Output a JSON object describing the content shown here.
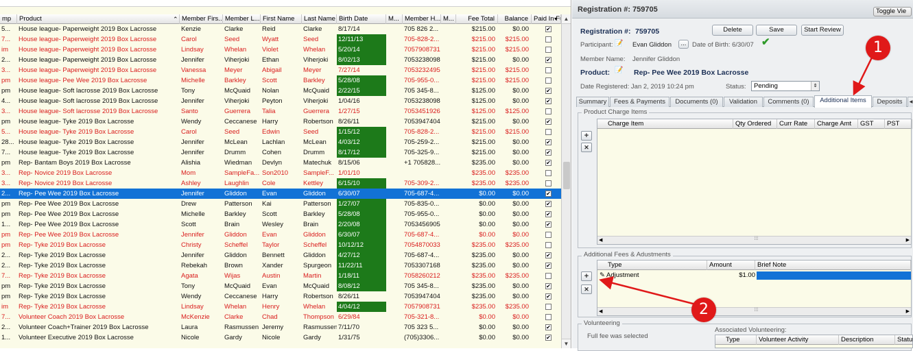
{
  "grid": {
    "columns": [
      {
        "label": "mp"
      },
      {
        "label": "Product"
      },
      {
        "label": "Member Firs..."
      },
      {
        "label": "Member L..."
      },
      {
        "label": "First Name"
      },
      {
        "label": "Last Name"
      },
      {
        "label": "Birth Date"
      },
      {
        "label": "M..."
      },
      {
        "label": "Member H..."
      },
      {
        "label": "M..."
      },
      {
        "label": "Fee Total"
      },
      {
        "label": "Balance"
      },
      {
        "label": "Paid In Fu"
      }
    ],
    "rows": [
      {
        "c0": "5...",
        "product": "House league- Paperweight 2019 Box Lacrosse",
        "mfirst": "Kenzie",
        "mlast": "Clarke",
        "first": "Reid",
        "last": "Clarke",
        "birth": "8/17/14",
        "green": false,
        "phone": "705 826 2...",
        "fee": "$215.00",
        "bal": "$0.00",
        "paid": true,
        "red": false
      },
      {
        "c0": "7...",
        "product": "House league- Paperweight 2019 Box Lacrosse",
        "mfirst": "Carol",
        "mlast": "Seed",
        "first": "Wyatt",
        "last": "Seed",
        "birth": "12/11/13",
        "green": true,
        "phone": "705-828-2...",
        "fee": "$215.00",
        "bal": "$215.00",
        "paid": false,
        "red": true
      },
      {
        "c0": "im",
        "product": "House league- Paperweight 2019 Box Lacrosse",
        "mfirst": "Lindsay",
        "mlast": "Whelan",
        "first": "Violet",
        "last": "Whelan",
        "birth": "5/20/14",
        "green": true,
        "phone": "7057908731",
        "fee": "$215.00",
        "bal": "$215.00",
        "paid": false,
        "red": true
      },
      {
        "c0": "2...",
        "product": "House league- Paperweight 2019 Box Lacrosse",
        "mfirst": "Jennifer",
        "mlast": "Viherjoki",
        "first": "Ethan",
        "last": "Viherjoki",
        "birth": "8/02/13",
        "green": true,
        "phone": "7053238098",
        "fee": "$215.00",
        "bal": "$0.00",
        "paid": true,
        "red": false
      },
      {
        "c0": "3...",
        "product": "House league- Paperweight 2019 Box Lacrosse",
        "mfirst": "Vanessa",
        "mlast": "Meyer",
        "first": "Abigail",
        "last": "Meyer",
        "birth": "7/27/14",
        "green": false,
        "phone": "7053232495",
        "fee": "$215.00",
        "bal": "$215.00",
        "paid": false,
        "red": true
      },
      {
        "c0": "pm",
        "product": "House league- Pee Wee 2019 Box Lacrosse",
        "mfirst": "Michelle",
        "mlast": "Barkley",
        "first": "Scott",
        "last": "Barkley",
        "birth": "5/28/08",
        "green": true,
        "phone": "705-955-0...",
        "fee": "$215.00",
        "bal": "$215.00",
        "paid": false,
        "red": true
      },
      {
        "c0": "pm",
        "product": "House league- Soft lacrosse 2019 Box Lacrosse",
        "mfirst": "Tony",
        "mlast": "McQuaid",
        "first": "Nolan",
        "last": "McQuaid",
        "birth": "2/22/15",
        "green": true,
        "phone": "705 345-8...",
        "fee": "$125.00",
        "bal": "$0.00",
        "paid": true,
        "red": false
      },
      {
        "c0": "4...",
        "product": "House league- Soft lacrosse 2019 Box Lacrosse",
        "mfirst": "Jennifer",
        "mlast": "Viherjoki",
        "first": "Peyton",
        "last": "Viherjoki",
        "birth": "1/04/16",
        "green": false,
        "phone": "7053238098",
        "fee": "$125.00",
        "bal": "$0.00",
        "paid": true,
        "red": false
      },
      {
        "c0": "3...",
        "product": "House league- Soft lacrosse 2019 Box Lacrosse",
        "mfirst": "Santo",
        "mlast": "Guerrera",
        "first": "Talia",
        "last": "Guerrera",
        "birth": "1/27/15",
        "green": false,
        "phone": "7053451926",
        "fee": "$125.00",
        "bal": "$125.00",
        "paid": false,
        "red": true
      },
      {
        "c0": "pm",
        "product": "House league- Tyke 2019 Box Lacrosse",
        "mfirst": "Wendy",
        "mlast": "Ceccanese",
        "first": "Harry",
        "last": "Robertson",
        "birth": "8/26/11",
        "green": false,
        "phone": "7053947404",
        "fee": "$215.00",
        "bal": "$0.00",
        "paid": true,
        "red": false
      },
      {
        "c0": "5...",
        "product": "House league- Tyke 2019 Box Lacrosse",
        "mfirst": "Carol",
        "mlast": "Seed",
        "first": "Edwin",
        "last": "Seed",
        "birth": "1/15/12",
        "green": true,
        "phone": "705-828-2...",
        "fee": "$215.00",
        "bal": "$215.00",
        "paid": false,
        "red": true
      },
      {
        "c0": "28...",
        "product": "House league- Tyke 2019 Box Lacrosse",
        "mfirst": "Jennifer",
        "mlast": "McLean",
        "first": "Lachlan",
        "last": "McLean",
        "birth": "4/03/12",
        "green": true,
        "phone": "705-259-2...",
        "fee": "$215.00",
        "bal": "$0.00",
        "paid": true,
        "red": false
      },
      {
        "c0": "7...",
        "product": "House league- Tyke 2019 Box Lacrosse",
        "mfirst": "Jennifer",
        "mlast": "Drumm",
        "first": "Cohen",
        "last": "Drumm",
        "birth": "8/17/12",
        "green": true,
        "phone": "705-325-9...",
        "fee": "$215.00",
        "bal": "$0.00",
        "paid": true,
        "red": false
      },
      {
        "c0": "pm",
        "product": "Rep- Bantam Boys 2019 Box Lacrosse",
        "mfirst": "Alishia",
        "mlast": "Wiedman",
        "first": "Devlyn",
        "last": "Matechuk",
        "birth": "8/15/06",
        "green": false,
        "phone": "+1 705828...",
        "fee": "$235.00",
        "bal": "$0.00",
        "paid": true,
        "red": false
      },
      {
        "c0": "3...",
        "product": "Rep- Novice 2019 Box Lacrosse",
        "mfirst": "Mom",
        "mlast": "SampleFa...",
        "first": "Son2010",
        "last": "SampleF...",
        "birth": "1/01/10",
        "green": false,
        "phone": "",
        "fee": "$235.00",
        "bal": "$235.00",
        "paid": false,
        "red": true
      },
      {
        "c0": "3...",
        "product": "Rep- Novice 2019 Box Lacrosse",
        "mfirst": "Ashley",
        "mlast": "Laughlin",
        "first": "Cole",
        "last": "Kettley",
        "birth": "6/15/10",
        "green": true,
        "phone": "705-309-2...",
        "fee": "$235.00",
        "bal": "$235.00",
        "paid": false,
        "red": true
      },
      {
        "c0": "2...",
        "product": "Rep- Pee Wee 2019 Box Lacrosse",
        "mfirst": "Jennifer",
        "mlast": "Gliddon",
        "first": "Evan",
        "last": "Gliddon",
        "birth": "6/30/07",
        "green": false,
        "phone": "705-687-4...",
        "fee": "$0.00",
        "bal": "$0.00",
        "paid": true,
        "red": false,
        "selected": true
      },
      {
        "c0": "pm",
        "product": "Rep- Pee Wee 2019 Box Lacrosse",
        "mfirst": "Drew",
        "mlast": "Patterson",
        "first": "Kai",
        "last": "Patterson",
        "birth": "1/27/07",
        "green": true,
        "phone": "705-835-0...",
        "fee": "$0.00",
        "bal": "$0.00",
        "paid": true,
        "red": false
      },
      {
        "c0": "pm",
        "product": "Rep- Pee Wee 2019 Box Lacrosse",
        "mfirst": "Michelle",
        "mlast": "Barkley",
        "first": "Scott",
        "last": "Barkley",
        "birth": "5/28/08",
        "green": true,
        "phone": "705-955-0...",
        "fee": "$0.00",
        "bal": "$0.00",
        "paid": true,
        "red": false
      },
      {
        "c0": "1...",
        "product": "Rep- Pee Wee 2019 Box Lacrosse",
        "mfirst": "Scott",
        "mlast": "Brain",
        "first": "Wesley",
        "last": "Brain",
        "birth": "2/20/08",
        "green": true,
        "phone": "7053456905",
        "fee": "$0.00",
        "bal": "$0.00",
        "paid": true,
        "red": false
      },
      {
        "c0": "pm",
        "product": "Rep- Pee Wee 2019 Box Lacrosse",
        "mfirst": "Jennifer",
        "mlast": "Gliddon",
        "first": "Evan",
        "last": "Gliddon",
        "birth": "6/30/07",
        "green": true,
        "phone": "705-687-4...",
        "fee": "$0.00",
        "bal": "$0.00",
        "paid": false,
        "red": true
      },
      {
        "c0": "pm",
        "product": "Rep- Tyke 2019 Box Lacrosse",
        "mfirst": "Christy",
        "mlast": "Scheffel",
        "first": "Taylor",
        "last": "Scheffel",
        "birth": "10/12/12",
        "green": true,
        "phone": "7054870033",
        "fee": "$235.00",
        "bal": "$235.00",
        "paid": false,
        "red": true
      },
      {
        "c0": "2...",
        "product": "Rep- Tyke 2019 Box Lacrosse",
        "mfirst": "Jennifer",
        "mlast": "Gliddon",
        "first": "Bennett",
        "last": "Gliddon",
        "birth": "4/27/12",
        "green": true,
        "phone": "705-687-4...",
        "fee": "$235.00",
        "bal": "$0.00",
        "paid": true,
        "red": false
      },
      {
        "c0": "2...",
        "product": "Rep- Tyke 2019 Box Lacrosse",
        "mfirst": "Rebekah",
        "mlast": "Brown",
        "first": "Xander",
        "last": "Spurgeon",
        "birth": "11/22/11",
        "green": true,
        "phone": "7053307168",
        "fee": "$235.00",
        "bal": "$0.00",
        "paid": true,
        "red": false
      },
      {
        "c0": "7...",
        "product": "Rep- Tyke 2019 Box Lacrosse",
        "mfirst": "Agata",
        "mlast": "Wijas",
        "first": "Austin",
        "last": "Martin",
        "birth": "1/18/11",
        "green": true,
        "phone": "7058260212",
        "fee": "$235.00",
        "bal": "$235.00",
        "paid": false,
        "red": true
      },
      {
        "c0": "pm",
        "product": "Rep- Tyke 2019 Box Lacrosse",
        "mfirst": "Tony",
        "mlast": "McQuaid",
        "first": "Evan",
        "last": "McQuaid",
        "birth": "8/08/12",
        "green": true,
        "phone": "705 345-8...",
        "fee": "$235.00",
        "bal": "$0.00",
        "paid": true,
        "red": false
      },
      {
        "c0": "pm",
        "product": "Rep- Tyke 2019 Box Lacrosse",
        "mfirst": "Wendy",
        "mlast": "Ceccanese",
        "first": "Harry",
        "last": "Robertson",
        "birth": "8/26/11",
        "green": false,
        "phone": "7053947404",
        "fee": "$235.00",
        "bal": "$0.00",
        "paid": true,
        "red": false
      },
      {
        "c0": "im",
        "product": "Rep- Tyke 2019 Box Lacrosse",
        "mfirst": "Lindsay",
        "mlast": "Whelan",
        "first": "Henry",
        "last": "Whelan",
        "birth": "4/04/12",
        "green": true,
        "phone": "7057908731",
        "fee": "$235.00",
        "bal": "$235.00",
        "paid": false,
        "red": true
      },
      {
        "c0": "7...",
        "product": "Volunteer Coach 2019 Box Lacrosse",
        "mfirst": "McKenzie",
        "mlast": "Clarke",
        "first": "Chad",
        "last": "Thompson",
        "birth": "6/29/84",
        "green": false,
        "phone": "705-321-8...",
        "fee": "$0.00",
        "bal": "$0.00",
        "paid": false,
        "red": true
      },
      {
        "c0": "2...",
        "product": "Volunteer Coach+Trainer 2019 Box Lacrosse",
        "mfirst": "Laura",
        "mlast": "Rasmussen",
        "first": "Jeremy",
        "last": "Rasmussen",
        "birth": "7/11/70",
        "green": false,
        "phone": "705 323 5...",
        "fee": "$0.00",
        "bal": "$0.00",
        "paid": true,
        "red": false
      },
      {
        "c0": "1...",
        "product": "Volunteer Executive 2019 Box Lacrosse",
        "mfirst": "Nicole",
        "mlast": "Gardy",
        "first": "Nicole",
        "last": "Gardy",
        "birth": "1/31/75",
        "green": false,
        "phone": "(705)3306...",
        "fee": "$0.00",
        "bal": "$0.00",
        "paid": true,
        "red": false
      }
    ]
  },
  "panel": {
    "header_title": "Registration #: 759705",
    "toggle_view_label": "Toggle Vie",
    "reg_label": "Registration #:",
    "reg_value": "759705",
    "delete_label": "Delete",
    "save_label": "Save",
    "start_review_label": "Start Review",
    "participant_label": "Participant:",
    "participant_value": "Evan Gliddon",
    "ellipsis_label": "...",
    "dob_label": "Date of Birth: 6/30/07",
    "member_name_label": "Member Name:",
    "member_name_value": "Jennifer Gliddon",
    "product_label": "Product:",
    "product_value": "Rep- Pee Wee 2019 Box Lacrosse",
    "date_registered_label": "Date Registered: Jan 2, 2019 10:24 pm",
    "status_label": "Status:",
    "status_value": "Pending",
    "tabs": [
      {
        "label": "Summary"
      },
      {
        "label": "Fees & Payments"
      },
      {
        "label": "Documents (0)"
      },
      {
        "label": "Validation"
      },
      {
        "label": "Comments (0)"
      },
      {
        "label": "Additional Items"
      },
      {
        "label": "Deposits"
      }
    ],
    "product_charge_title": "Product Charge Items",
    "charge_columns": [
      {
        "label": "Charge Item"
      },
      {
        "label": "Qty Ordered"
      },
      {
        "label": "Curr Rate"
      },
      {
        "label": "Charge Amt"
      },
      {
        "label": "GST"
      },
      {
        "label": "PST"
      }
    ],
    "additional_fees_title": "Additional Fees & Adustments",
    "fees_columns": [
      {
        "label": "Type"
      },
      {
        "label": "Amount"
      },
      {
        "label": "Brief Note"
      }
    ],
    "fee_row": {
      "type": "Adjustment",
      "amount": "$1.00"
    },
    "volunteering_title": "Volunteering",
    "full_fee_text": "Full fee was selected",
    "assoc_vol_title": "Associated Volunteering:",
    "vol_columns": [
      {
        "label": "Type"
      },
      {
        "label": "Volunteer Activity"
      },
      {
        "label": "Description"
      },
      {
        "label": "Status"
      }
    ],
    "plus_symbol": "+",
    "x_symbol": "✕"
  },
  "annotations": {
    "badge1": "1",
    "badge2": "2"
  },
  "colors": {
    "red_text": "#d91c1c",
    "green_cell": "#1d7a1a",
    "selected_row": "#1272d6",
    "grid_bg": "#fbfbe8"
  }
}
